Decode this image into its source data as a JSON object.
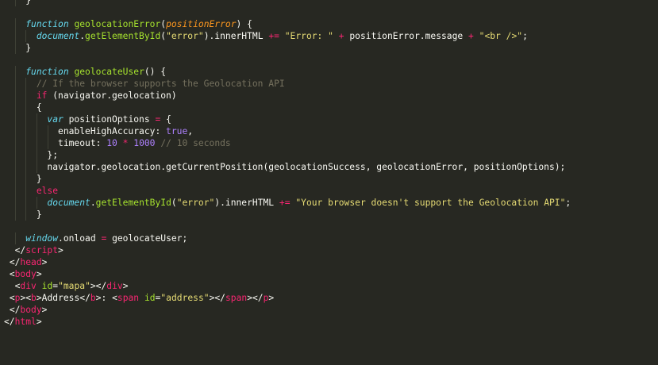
{
  "theme": {
    "background": "#272822",
    "text": "#f8f8f2",
    "keyword": "#66d9ef",
    "function": "#a6e22e",
    "parameter": "#fd971f",
    "string": "#e6db74",
    "operator": "#f92672",
    "comment": "#75715e",
    "number": "#ae81ff"
  },
  "lines": [
    {
      "indent": 4,
      "tokens": [
        {
          "t": "}",
          "c": "plain"
        }
      ]
    },
    {
      "indent": 0,
      "tokens": []
    },
    {
      "indent": 4,
      "tokens": [
        {
          "t": "function",
          "c": "kw"
        },
        {
          "t": " ",
          "c": "plain"
        },
        {
          "t": "geolocationError",
          "c": "fn"
        },
        {
          "t": "(",
          "c": "plain"
        },
        {
          "t": "positionError",
          "c": "param"
        },
        {
          "t": ") {",
          "c": "plain"
        }
      ]
    },
    {
      "indent": 6,
      "tokens": [
        {
          "t": "document",
          "c": "obj"
        },
        {
          "t": ".",
          "c": "plain"
        },
        {
          "t": "getElementById",
          "c": "method"
        },
        {
          "t": "(",
          "c": "plain"
        },
        {
          "t": "\"error\"",
          "c": "str"
        },
        {
          "t": ").innerHTML ",
          "c": "plain"
        },
        {
          "t": "+=",
          "c": "op"
        },
        {
          "t": " ",
          "c": "plain"
        },
        {
          "t": "\"Error: \"",
          "c": "str"
        },
        {
          "t": " ",
          "c": "plain"
        },
        {
          "t": "+",
          "c": "op"
        },
        {
          "t": " positionError.message ",
          "c": "plain"
        },
        {
          "t": "+",
          "c": "op"
        },
        {
          "t": " ",
          "c": "plain"
        },
        {
          "t": "\"<br />\"",
          "c": "str"
        },
        {
          "t": ";",
          "c": "plain"
        }
      ]
    },
    {
      "indent": 4,
      "tokens": [
        {
          "t": "}",
          "c": "plain"
        }
      ]
    },
    {
      "indent": 0,
      "tokens": []
    },
    {
      "indent": 4,
      "tokens": [
        {
          "t": "function",
          "c": "kw"
        },
        {
          "t": " ",
          "c": "plain"
        },
        {
          "t": "geolocateUser",
          "c": "fn"
        },
        {
          "t": "() {",
          "c": "plain"
        }
      ]
    },
    {
      "indent": 6,
      "tokens": [
        {
          "t": "// If the browser supports the Geolocation API",
          "c": "cmt"
        }
      ]
    },
    {
      "indent": 6,
      "tokens": [
        {
          "t": "if",
          "c": "ctrl"
        },
        {
          "t": " (navigator.geolocation)",
          "c": "plain"
        }
      ]
    },
    {
      "indent": 6,
      "tokens": [
        {
          "t": "{",
          "c": "plain"
        }
      ]
    },
    {
      "indent": 8,
      "tokens": [
        {
          "t": "var",
          "c": "kw"
        },
        {
          "t": " positionOptions ",
          "c": "plain"
        },
        {
          "t": "=",
          "c": "op"
        },
        {
          "t": " {",
          "c": "plain"
        }
      ]
    },
    {
      "indent": 10,
      "tokens": [
        {
          "t": "enableHighAccuracy: ",
          "c": "plain"
        },
        {
          "t": "true",
          "c": "bool"
        },
        {
          "t": ",",
          "c": "plain"
        }
      ]
    },
    {
      "indent": 10,
      "tokens": [
        {
          "t": "timeout: ",
          "c": "plain"
        },
        {
          "t": "10",
          "c": "num"
        },
        {
          "t": " ",
          "c": "plain"
        },
        {
          "t": "*",
          "c": "op"
        },
        {
          "t": " ",
          "c": "plain"
        },
        {
          "t": "1000",
          "c": "num"
        },
        {
          "t": " ",
          "c": "plain"
        },
        {
          "t": "// 10 seconds",
          "c": "cmt"
        }
      ]
    },
    {
      "indent": 8,
      "tokens": [
        {
          "t": "};",
          "c": "plain"
        }
      ]
    },
    {
      "indent": 8,
      "tokens": [
        {
          "t": "navigator.geolocation.getCurrentPosition(geolocationSuccess, geolocationError, positionOptions);",
          "c": "plain"
        }
      ]
    },
    {
      "indent": 6,
      "tokens": [
        {
          "t": "}",
          "c": "plain"
        }
      ]
    },
    {
      "indent": 6,
      "tokens": [
        {
          "t": "else",
          "c": "ctrl"
        }
      ]
    },
    {
      "indent": 8,
      "tokens": [
        {
          "t": "document",
          "c": "obj"
        },
        {
          "t": ".",
          "c": "plain"
        },
        {
          "t": "getElementById",
          "c": "method"
        },
        {
          "t": "(",
          "c": "plain"
        },
        {
          "t": "\"error\"",
          "c": "str"
        },
        {
          "t": ").innerHTML ",
          "c": "plain"
        },
        {
          "t": "+=",
          "c": "op"
        },
        {
          "t": " ",
          "c": "plain"
        },
        {
          "t": "\"Your browser doesn't support the Geolocation API\"",
          "c": "str"
        },
        {
          "t": ";",
          "c": "plain"
        }
      ]
    },
    {
      "indent": 6,
      "tokens": [
        {
          "t": "}",
          "c": "plain"
        }
      ]
    },
    {
      "indent": 0,
      "tokens": []
    },
    {
      "indent": 4,
      "tokens": [
        {
          "t": "window",
          "c": "obj"
        },
        {
          "t": ".onload ",
          "c": "plain"
        },
        {
          "t": "=",
          "c": "op"
        },
        {
          "t": " geolocateUser;",
          "c": "plain"
        }
      ]
    },
    {
      "indent": 2,
      "tokens": [
        {
          "t": "</",
          "c": "plain"
        },
        {
          "t": "script",
          "c": "tag"
        },
        {
          "t": ">",
          "c": "plain"
        }
      ]
    },
    {
      "indent": 1,
      "tokens": [
        {
          "t": "</",
          "c": "plain"
        },
        {
          "t": "head",
          "c": "tag"
        },
        {
          "t": ">",
          "c": "plain"
        }
      ]
    },
    {
      "indent": 1,
      "tokens": [
        {
          "t": "<",
          "c": "plain"
        },
        {
          "t": "body",
          "c": "tag"
        },
        {
          "t": ">",
          "c": "plain"
        }
      ]
    },
    {
      "indent": 2,
      "tokens": [
        {
          "t": "<",
          "c": "plain"
        },
        {
          "t": "div",
          "c": "tag"
        },
        {
          "t": " ",
          "c": "plain"
        },
        {
          "t": "id",
          "c": "attr"
        },
        {
          "t": "=",
          "c": "plain"
        },
        {
          "t": "\"mapa\"",
          "c": "str"
        },
        {
          "t": "></",
          "c": "plain"
        },
        {
          "t": "div",
          "c": "tag"
        },
        {
          "t": ">",
          "c": "plain"
        }
      ]
    },
    {
      "indent": 1,
      "tokens": [
        {
          "t": "<",
          "c": "plain"
        },
        {
          "t": "p",
          "c": "tag"
        },
        {
          "t": "><",
          "c": "plain"
        },
        {
          "t": "b",
          "c": "tag"
        },
        {
          "t": ">Address</",
          "c": "plain"
        },
        {
          "t": "b",
          "c": "tag"
        },
        {
          "t": ">: <",
          "c": "plain"
        },
        {
          "t": "span",
          "c": "tag"
        },
        {
          "t": " ",
          "c": "plain"
        },
        {
          "t": "id",
          "c": "attr"
        },
        {
          "t": "=",
          "c": "plain"
        },
        {
          "t": "\"address\"",
          "c": "str"
        },
        {
          "t": "></",
          "c": "plain"
        },
        {
          "t": "span",
          "c": "tag"
        },
        {
          "t": "></",
          "c": "plain"
        },
        {
          "t": "p",
          "c": "tag"
        },
        {
          "t": ">",
          "c": "plain"
        }
      ]
    },
    {
      "indent": 1,
      "tokens": [
        {
          "t": "</",
          "c": "plain"
        },
        {
          "t": "body",
          "c": "tag"
        },
        {
          "t": ">",
          "c": "plain"
        }
      ]
    },
    {
      "indent": 0,
      "tokens": [
        {
          "t": "</",
          "c": "plain"
        },
        {
          "t": "html",
          "c": "tag"
        },
        {
          "t": ">",
          "c": "plain"
        }
      ]
    }
  ]
}
